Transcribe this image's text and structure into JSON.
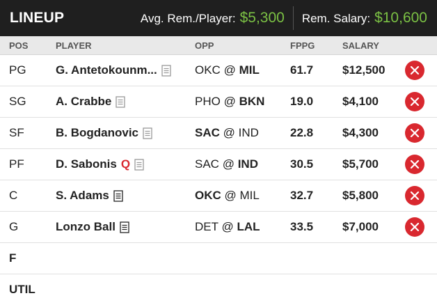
{
  "header": {
    "title": "LINEUP",
    "avg_label": "Avg. Rem./Player:",
    "avg_value": "$5,300",
    "rem_label": "Rem. Salary:",
    "rem_value": "$10,600"
  },
  "columns": {
    "pos": "POS",
    "player": "PLAYER",
    "opp": "OPP",
    "fppg": "FPPG",
    "salary": "SALARY"
  },
  "rows": [
    {
      "pos": "PG",
      "player": "G. Antetokounm...",
      "injury": "",
      "note_style": "light",
      "away": "OKC",
      "at": "@",
      "home": "MIL",
      "bold_team": "home",
      "fppg": "61.7",
      "salary": "$12,500"
    },
    {
      "pos": "SG",
      "player": "A. Crabbe",
      "injury": "",
      "note_style": "light",
      "away": "PHO",
      "at": "@",
      "home": "BKN",
      "bold_team": "home",
      "fppg": "19.0",
      "salary": "$4,100"
    },
    {
      "pos": "SF",
      "player": "B. Bogdanovic",
      "injury": "",
      "note_style": "light",
      "away": "SAC",
      "at": "@",
      "home": "IND",
      "bold_team": "away",
      "fppg": "22.8",
      "salary": "$4,300"
    },
    {
      "pos": "PF",
      "player": "D. Sabonis",
      "injury": "Q",
      "note_style": "light",
      "away": "SAC",
      "at": "@",
      "home": "IND",
      "bold_team": "home",
      "fppg": "30.5",
      "salary": "$5,700"
    },
    {
      "pos": "C",
      "player": "S. Adams",
      "injury": "",
      "note_style": "dark",
      "away": "OKC",
      "at": "@",
      "home": "MIL",
      "bold_team": "away",
      "fppg": "32.7",
      "salary": "$5,800"
    },
    {
      "pos": "G",
      "player": "Lonzo Ball",
      "injury": "",
      "note_style": "dark",
      "away": "DET",
      "at": "@",
      "home": "LAL",
      "bold_team": "home",
      "fppg": "33.5",
      "salary": "$7,000"
    }
  ],
  "empty_slots": [
    "F",
    "UTIL"
  ],
  "icons": {
    "note": "player-note-icon",
    "remove": "remove-player-icon"
  },
  "colors": {
    "header_bg": "#1f1f1f",
    "accent_green": "#7bc144",
    "remove_red": "#d9282f",
    "injury_red": "#d9282f"
  }
}
